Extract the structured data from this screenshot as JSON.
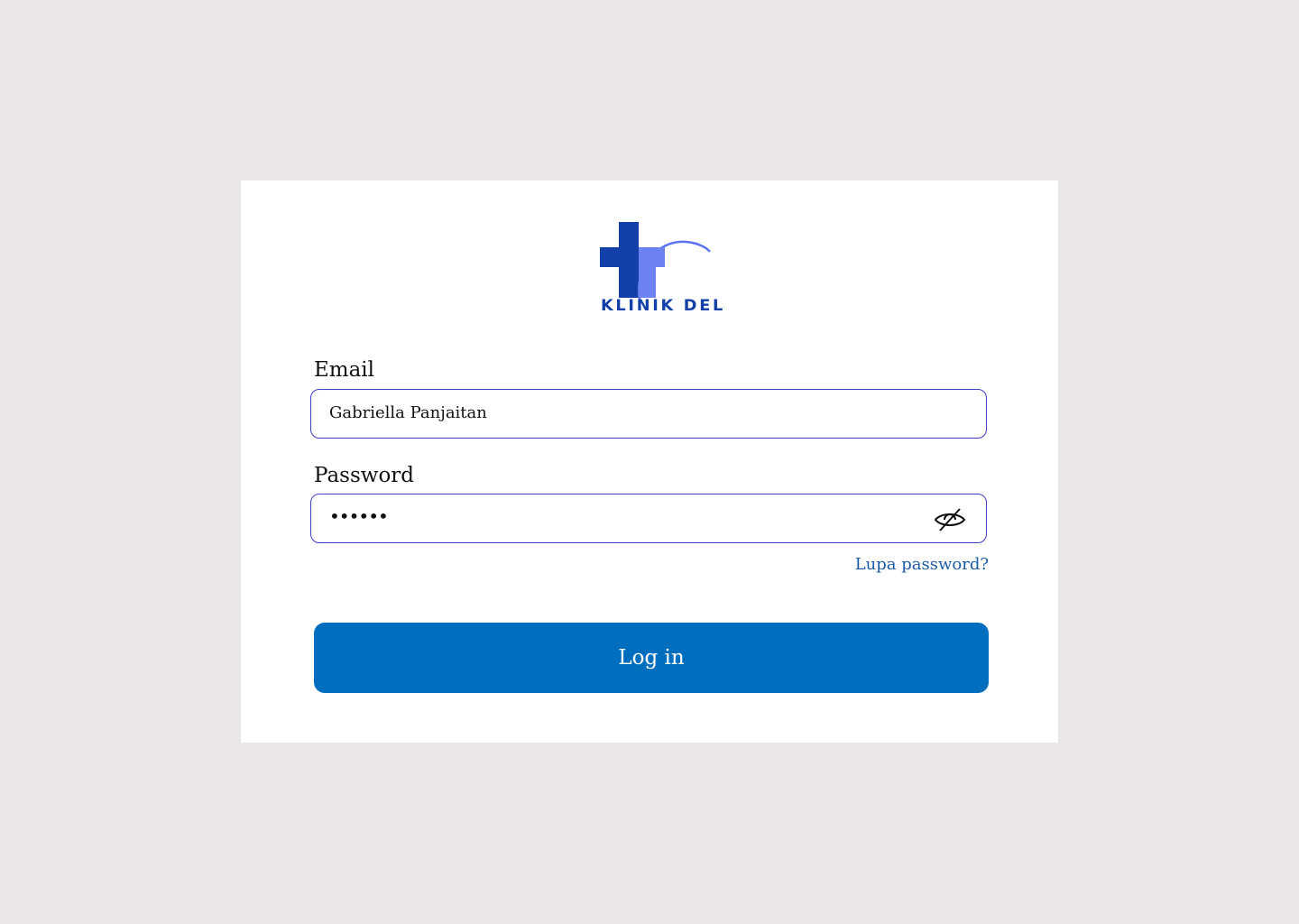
{
  "brand": {
    "name": "KLINIK DEL",
    "cross_color": "#1240A8",
    "accent_color": "#5C74F0"
  },
  "form": {
    "email_label": "Email",
    "email_value": "Gabriella Panjaitan",
    "password_label": "Password",
    "password_mask": "••••••",
    "password_toggle_icon": "eye-off-icon",
    "forgot_password": "Lupa password?",
    "login_button": "Log in"
  },
  "colors": {
    "background": "#EAE6E5",
    "card": "#FFFFFF",
    "input_border": "#3F3FC0",
    "link": "#1C5BA9",
    "primary_button": "#006EBE"
  }
}
